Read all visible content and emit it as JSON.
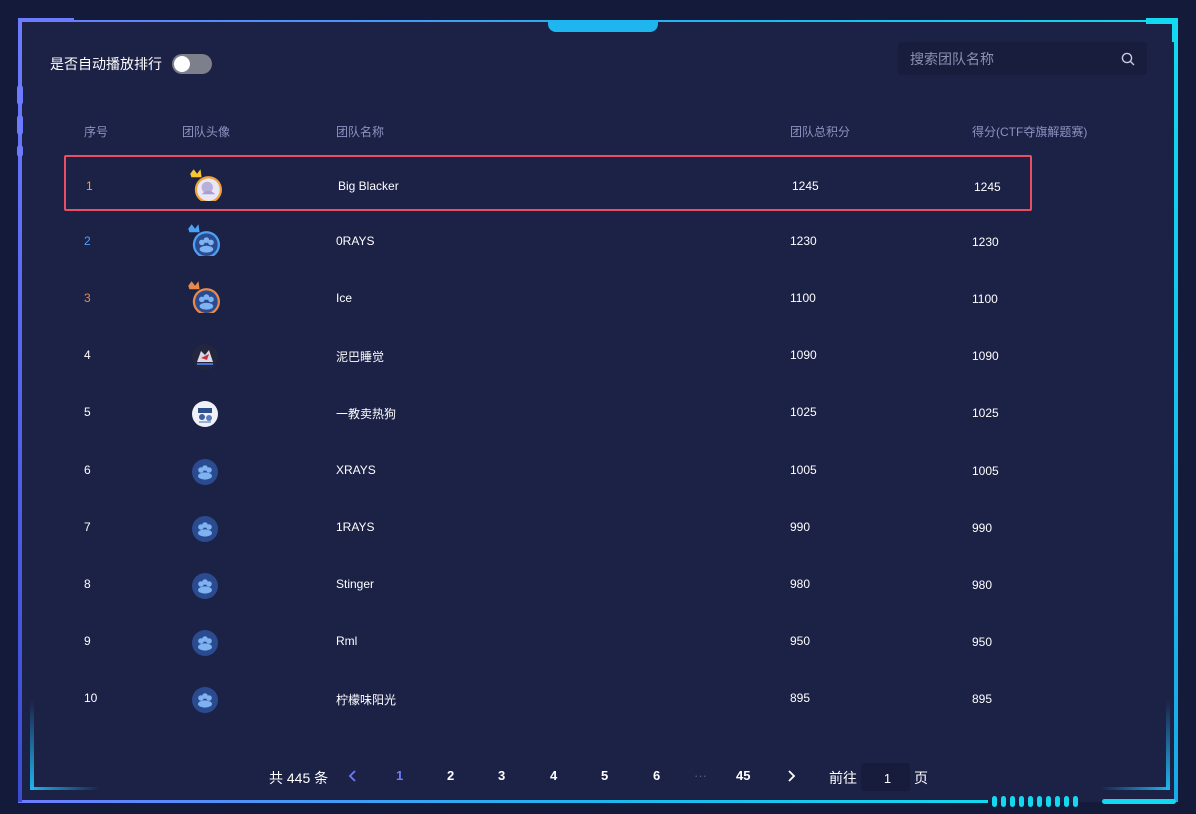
{
  "autoplay": {
    "label": "是否自动播放排行",
    "enabled": false
  },
  "search": {
    "placeholder": "搜索团队名称"
  },
  "table": {
    "headers": {
      "rank": "序号",
      "avatar": "团队头像",
      "name": "团队名称",
      "total": "团队总积分",
      "ctf": "得分(CTF夺旗解题赛)"
    },
    "rows": [
      {
        "rank": "1",
        "name": "Big Blacker",
        "total": "1245",
        "ctf": "1245",
        "avatar": "crown-gold-avatar",
        "rank_color": "#f0a13a"
      },
      {
        "rank": "2",
        "name": "0RAYS",
        "total": "1230",
        "ctf": "1230",
        "avatar": "crown-blue-avatar",
        "rank_color": "#4ea0f5"
      },
      {
        "rank": "3",
        "name": "Ice",
        "total": "1100",
        "ctf": "1100",
        "avatar": "crown-orange-avatar",
        "rank_color": "#e9894a"
      },
      {
        "rank": "4",
        "name": "泥巴睡觉",
        "total": "1090",
        "ctf": "1090",
        "avatar": "wolf-avatar",
        "rank_color": "#ffffff"
      },
      {
        "rank": "5",
        "name": "一教卖热狗",
        "total": "1025",
        "ctf": "1025",
        "avatar": "photo-avatar",
        "rank_color": "#ffffff"
      },
      {
        "rank": "6",
        "name": "XRAYS",
        "total": "1005",
        "ctf": "1005",
        "avatar": "team-avatar",
        "rank_color": "#ffffff"
      },
      {
        "rank": "7",
        "name": "1RAYS",
        "total": "990",
        "ctf": "990",
        "avatar": "team-avatar",
        "rank_color": "#ffffff"
      },
      {
        "rank": "8",
        "name": "Stinger",
        "total": "980",
        "ctf": "980",
        "avatar": "team-avatar",
        "rank_color": "#ffffff"
      },
      {
        "rank": "9",
        "name": "Rml",
        "total": "950",
        "ctf": "950",
        "avatar": "team-avatar",
        "rank_color": "#ffffff"
      },
      {
        "rank": "10",
        "name": "柠檬味阳光",
        "total": "895",
        "ctf": "895",
        "avatar": "team-avatar",
        "rank_color": "#ffffff"
      }
    ]
  },
  "pagination": {
    "total_prefix": "共",
    "total_count": "445",
    "total_suffix": "条",
    "pages": [
      "1",
      "2",
      "3",
      "4",
      "5",
      "6"
    ],
    "ellipsis": "···",
    "last_page": "45",
    "current_page": "1",
    "goto_prefix": "前往",
    "goto_value": "1",
    "goto_suffix": "页"
  },
  "colors": {
    "accent": "#6d7bff",
    "cyan": "#14d8ef",
    "highlight_border": "#e94f63",
    "background": "#1c2146"
  }
}
